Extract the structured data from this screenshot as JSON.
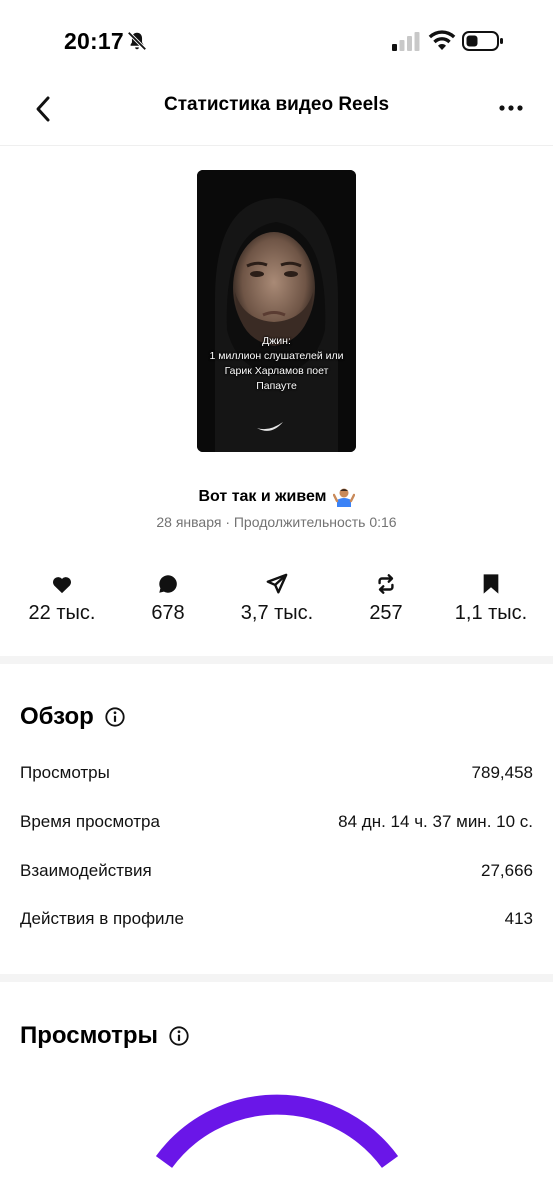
{
  "status_bar": {
    "time": "20:17",
    "icons": [
      "bell-slash-icon",
      "signal-icon",
      "wifi-icon",
      "battery-icon"
    ]
  },
  "nav": {
    "title": "Статистика видео Reels",
    "back_icon": "chevron-left-icon",
    "more_icon": "more-dots-icon"
  },
  "thumbnail": {
    "caption_lines": [
      "Джин:",
      "1 миллион слушателей или",
      "Гарик Харламов поет",
      "Папауте"
    ]
  },
  "video": {
    "title": "Вот так и живем",
    "title_emoji": "shrug-emoji",
    "meta": "28 января · Продолжительность 0:16"
  },
  "stats": [
    {
      "icon": "heart-icon",
      "value": "22 тыс."
    },
    {
      "icon": "comment-icon",
      "value": "678"
    },
    {
      "icon": "send-icon",
      "value": "3,7 тыс."
    },
    {
      "icon": "repost-icon",
      "value": "257"
    },
    {
      "icon": "bookmark-icon",
      "value": "1,1 тыс."
    }
  ],
  "overview": {
    "title": "Обзор",
    "rows": [
      {
        "label": "Просмотры",
        "value": "789,458"
      },
      {
        "label": "Время просмотра",
        "value": "84 дн. 14 ч. 37 мин. 10 с."
      },
      {
        "label": "Взаимодействия",
        "value": "27,666"
      },
      {
        "label": "Действия в профиле",
        "value": "413"
      }
    ]
  },
  "views_section": {
    "title": "Просмотры",
    "accent_color": "#6a16e8"
  }
}
